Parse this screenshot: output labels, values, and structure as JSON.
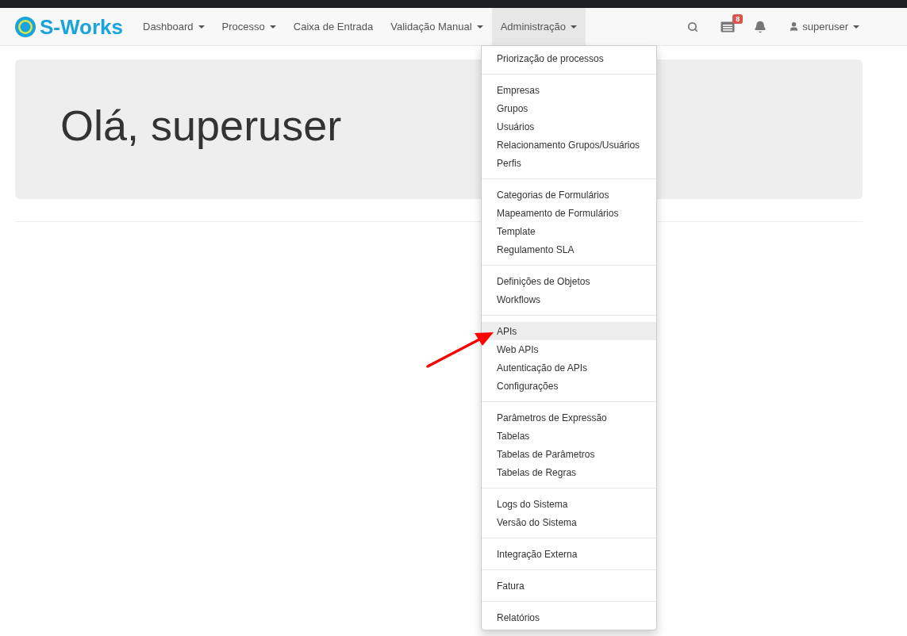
{
  "brand": {
    "name": "S-Works"
  },
  "nav": [
    {
      "label": "Dashboard",
      "has_caret": true,
      "selected": false
    },
    {
      "label": "Processo",
      "has_caret": true,
      "selected": false
    },
    {
      "label": "Caixa de Entrada",
      "has_caret": false,
      "selected": false
    },
    {
      "label": "Validação Manual",
      "has_caret": true,
      "selected": false
    },
    {
      "label": "Administração",
      "has_caret": true,
      "selected": true
    }
  ],
  "notifications_badge": "8",
  "user_menu": {
    "label": "superuser"
  },
  "dropdown": {
    "groups": [
      [
        {
          "label": "Priorização de processos",
          "selected": false
        }
      ],
      [
        {
          "label": "Empresas",
          "selected": false
        },
        {
          "label": "Grupos",
          "selected": false
        },
        {
          "label": "Usuários",
          "selected": false
        },
        {
          "label": "Relacionamento Grupos/Usuários",
          "selected": false
        },
        {
          "label": "Perfis",
          "selected": false
        }
      ],
      [
        {
          "label": "Categorias de Formulários",
          "selected": false
        },
        {
          "label": "Mapeamento de Formulários",
          "selected": false
        },
        {
          "label": "Template",
          "selected": false
        },
        {
          "label": "Regulamento SLA",
          "selected": false
        }
      ],
      [
        {
          "label": "Definições de Objetos",
          "selected": false
        },
        {
          "label": "Workflows",
          "selected": false
        }
      ],
      [
        {
          "label": "APIs",
          "selected": true
        },
        {
          "label": "Web APIs",
          "selected": false
        },
        {
          "label": "Autenticação de APIs",
          "selected": false
        },
        {
          "label": "Configurações",
          "selected": false
        }
      ],
      [
        {
          "label": "Parâmetros de Expressão",
          "selected": false
        },
        {
          "label": "Tabelas",
          "selected": false
        },
        {
          "label": "Tabelas de Parâmetros",
          "selected": false
        },
        {
          "label": "Tabelas de Regras",
          "selected": false
        }
      ],
      [
        {
          "label": "Logs do Sistema",
          "selected": false
        },
        {
          "label": "Versão do Sistema",
          "selected": false
        }
      ],
      [
        {
          "label": "Integração Externa",
          "selected": false
        }
      ],
      [
        {
          "label": "Fatura",
          "selected": false
        }
      ],
      [
        {
          "label": "Relatórios",
          "selected": false
        }
      ]
    ]
  },
  "hero": {
    "heading": "Olá, superuser"
  }
}
